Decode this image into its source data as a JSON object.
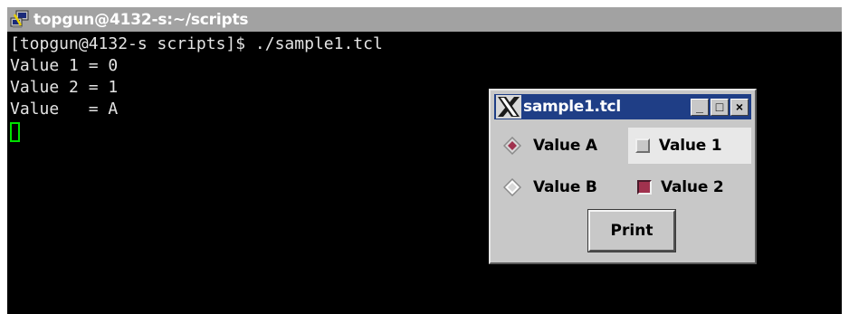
{
  "terminal": {
    "title": "topgun@4132-s:~/scripts",
    "lines": [
      "[topgun@4132-s scripts]$ ./sample1.tcl",
      "Value 1 = 0",
      "Value 2 = 1",
      "Value   = A"
    ],
    "icon": "putty-terminal-icon"
  },
  "dialog": {
    "title": "sample1.tcl",
    "icon": "x11-icon",
    "window_buttons": {
      "minimize": "_",
      "maximize": "□",
      "close": "×"
    },
    "radios": [
      {
        "label": "Value A",
        "selected": true
      },
      {
        "label": "Value B",
        "selected": false
      }
    ],
    "checks": [
      {
        "label": "Value 1",
        "checked": false
      },
      {
        "label": "Value 2",
        "checked": true
      }
    ],
    "print_label": "Print"
  },
  "colors": {
    "terminal_bg": "#000000",
    "terminal_text": "#e4e4e4",
    "cursor": "#00e000",
    "tk_title_bg": "#1f3e86",
    "tk_bg": "#c8c8c8",
    "indicator_on": "#a0324e"
  }
}
